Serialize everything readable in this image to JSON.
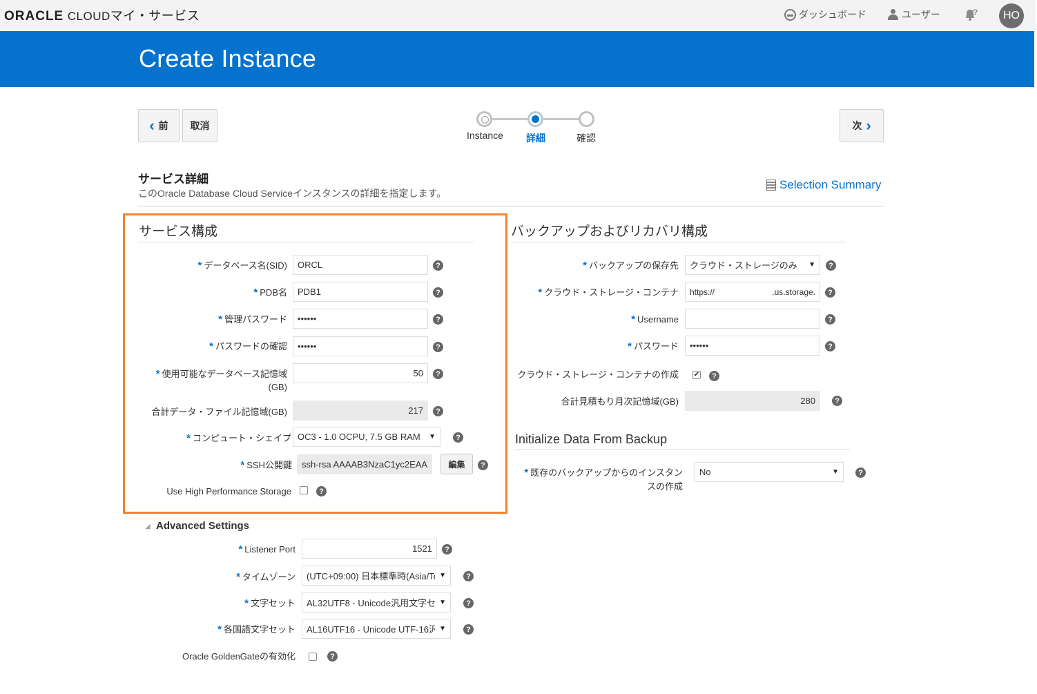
{
  "topbar": {
    "logo_oracle": "ORACLE",
    "logo_cloud": "CLOUD",
    "logo_service": "マイ・サービス",
    "dashboard_label": "ダッシュボード",
    "users_label": "ユーザー",
    "notif_icon": "bell-question-icon",
    "avatar_initials": "HO"
  },
  "banner": {
    "title": "Create Instance"
  },
  "nav": {
    "back_label": "前",
    "cancel_label": "取消",
    "next_label": "次"
  },
  "train": {
    "steps": [
      {
        "label": "Instance",
        "state": "done"
      },
      {
        "label": "詳細",
        "state": "active"
      },
      {
        "label": "確認",
        "state": "pending"
      }
    ]
  },
  "details": {
    "heading": "サービス詳細",
    "description": "このOracle Database Cloud Serviceインスタンスの詳細を指定します。",
    "selection_summary": "Selection Summary"
  },
  "service_config": {
    "title": "サービス構成",
    "sid_label": "データベース名(SID)",
    "sid_value": "ORCL",
    "pdb_label": "PDB名",
    "pdb_value": "PDB1",
    "admin_pw_label": "管理パスワード",
    "admin_pw_value": "••••••",
    "pw_confirm_label": "パスワードの確認",
    "pw_confirm_value": "••••••",
    "storage_label_1": "使用可能なデータベース記憶域",
    "storage_label_2": "(GB)",
    "storage_value": "50",
    "total_label": "合計データ・ファイル記憶域(GB)",
    "total_value": "217",
    "shape_label": "コンピュート・シェイプ",
    "shape_value": "OC3 - 1.0 OCPU, 7.5 GB RAM",
    "ssh_label": "SSH公開鍵",
    "ssh_value": "ssh-rsa AAAAB3NzaC1yc2EAA",
    "ssh_edit": "編集",
    "hps_label": "Use High Performance Storage"
  },
  "advanced": {
    "title": "Advanced Settings",
    "port_label": "Listener Port",
    "port_value": "1521",
    "tz_label": "タイムゾーン",
    "tz_value": "(UTC+09:00) 日本標準時(Asia/To",
    "charset_label": "文字セット",
    "charset_value": "AL32UTF8 - Unicode汎用文字セ",
    "ncharset_label": "各国語文字セット",
    "ncharset_value": "AL16UTF16 - Unicode UTF-16汎",
    "gg_label": "Oracle GoldenGateの有効化"
  },
  "backup": {
    "title": "バックアップおよびリカバリ構成",
    "dest_label": "バックアップの保存先",
    "dest_value": "クラウド・ストレージのみ",
    "container_label": "クラウド・ストレージ・コンテナ",
    "container_value_start": "https://",
    "container_value_end": ".us.storage.",
    "username_label": "Username",
    "username_value": "",
    "password_label": "パスワード",
    "password_value": "••••••",
    "create_container_label": "クラウド・ストレージ・コンテナの作成",
    "create_container_checked": "✔",
    "monthly_label": "合計見積もり月次記憶域(GB)",
    "monthly_value": "280"
  },
  "init_backup": {
    "title": "Initialize Data From Backup",
    "create_label_1": "既存のバックアップからのインスタン",
    "create_label_2": "スの作成",
    "create_value": "No"
  }
}
